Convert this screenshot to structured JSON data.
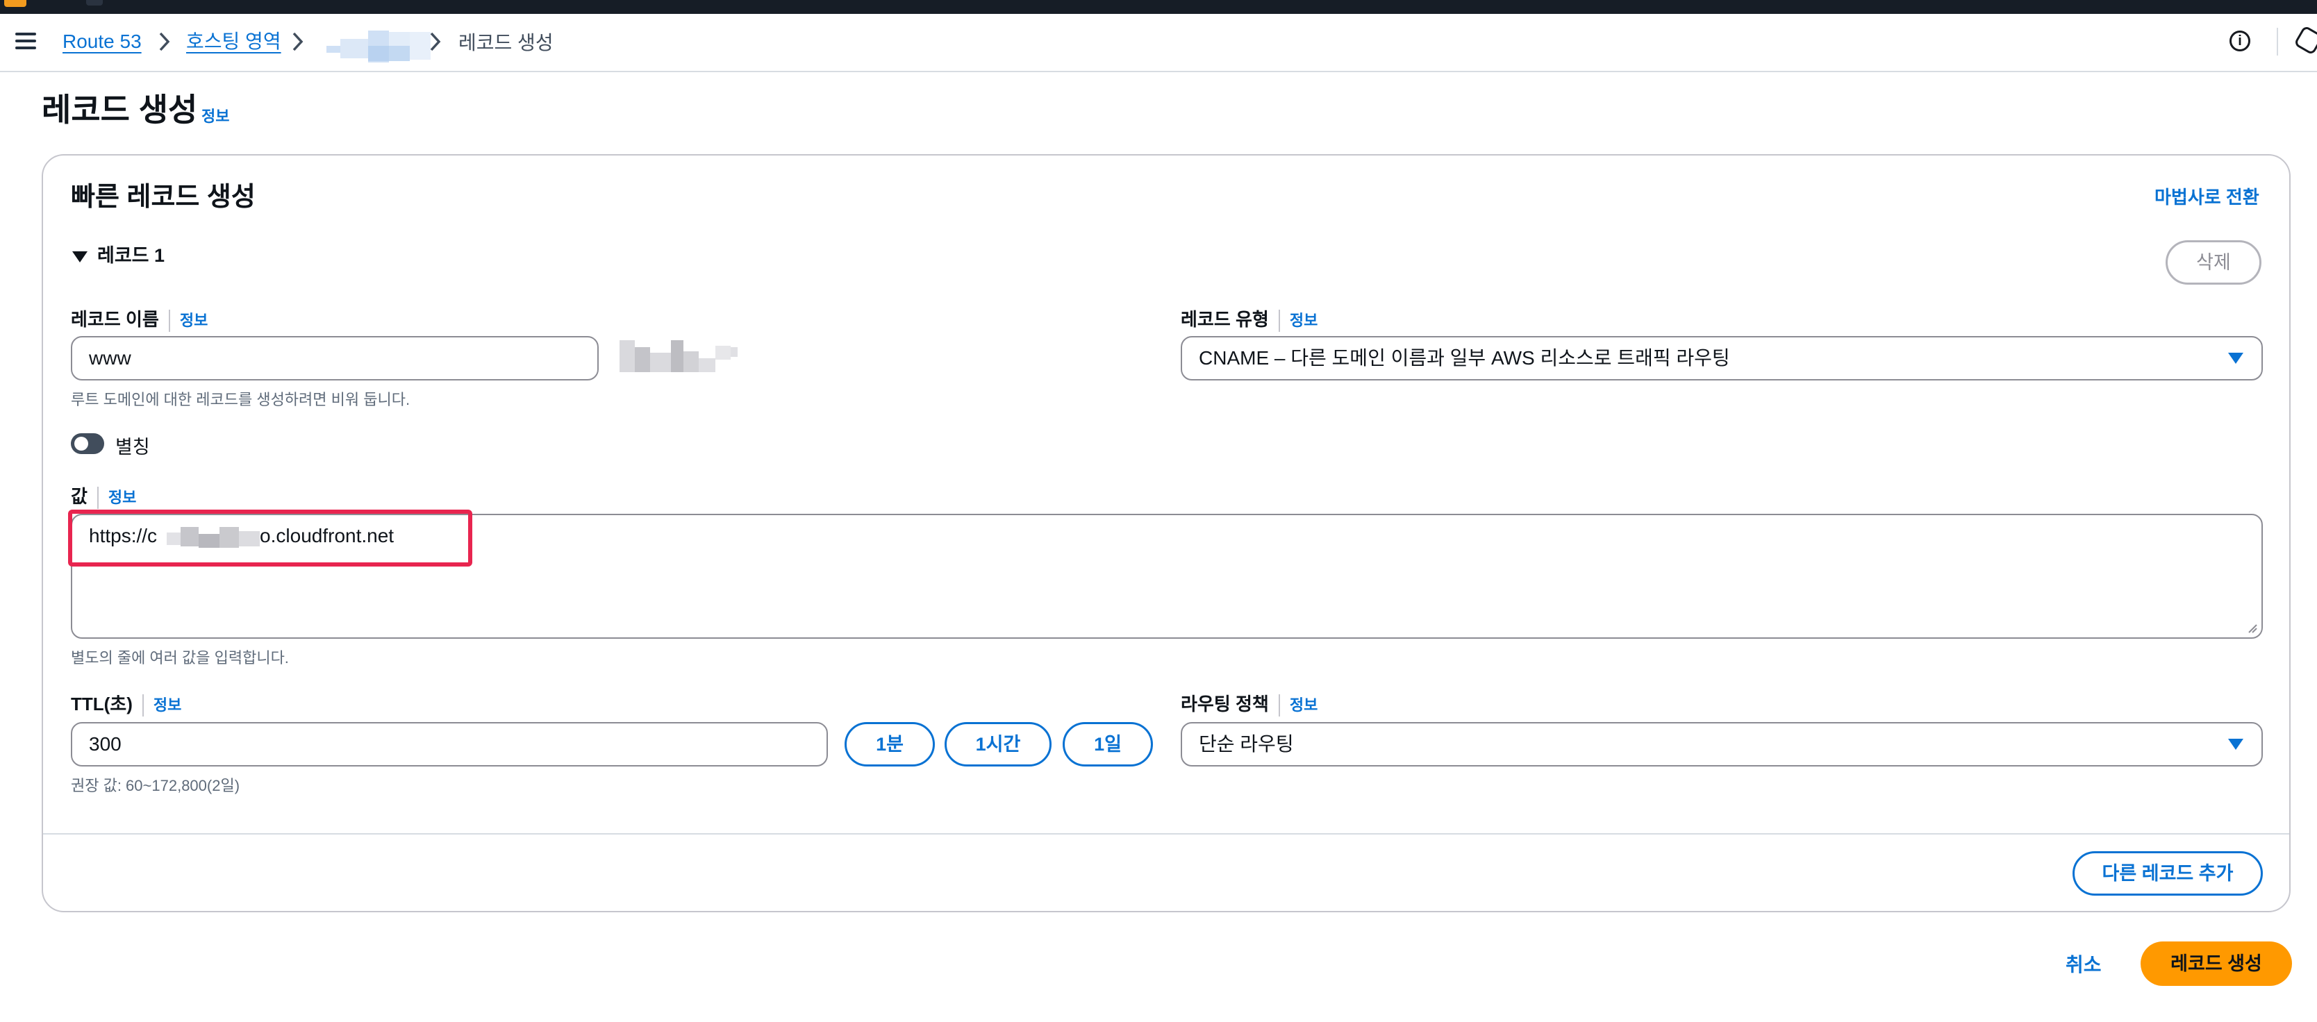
{
  "breadcrumb": {
    "items": [
      "Route 53",
      "호스팅 영역"
    ],
    "current": "레코드 생성"
  },
  "page": {
    "title": "레코드 생성",
    "info": "정보"
  },
  "card": {
    "title": "빠른 레코드 생성",
    "switch_link": "마법사로 전환",
    "record_header": "레코드 1",
    "delete_button": "삭제"
  },
  "record_name": {
    "label": "레코드 이름",
    "info": "정보",
    "value": "www",
    "hint": "루트 도메인에 대한 레코드를 생성하려면 비워 둡니다."
  },
  "record_type": {
    "label": "레코드 유형",
    "info": "정보",
    "selected": "CNAME – 다른 도메인 이름과 일부 AWS 리소스로 트래픽 라우팅"
  },
  "alias": {
    "label": "별칭",
    "enabled": false
  },
  "value_field": {
    "label": "값",
    "info": "정보",
    "value_prefix": "https://c",
    "value_suffix": "o.cloudfront.net",
    "hint": "별도의 줄에 여러 값을 입력합니다."
  },
  "ttl": {
    "label": "TTL(초)",
    "info": "정보",
    "value": "300",
    "hint": "권장 값: 60~172,800(2일)",
    "presets": [
      "1분",
      "1시간",
      "1일"
    ]
  },
  "routing_policy": {
    "label": "라우팅 정책",
    "info": "정보",
    "selected": "단순 라우팅"
  },
  "add_record_button": "다른 레코드 추가",
  "actions": {
    "cancel": "취소",
    "create": "레코드 생성"
  },
  "colors": {
    "link": "#0972d3",
    "primary_button": "#ff9900",
    "highlight_border": "#e8254f",
    "top_bar": "#161d26"
  },
  "icons": [
    "menu-icon",
    "chevron-right-icon",
    "info-icon",
    "settings-icon",
    "caret-down-icon",
    "triangle-down-icon"
  ]
}
